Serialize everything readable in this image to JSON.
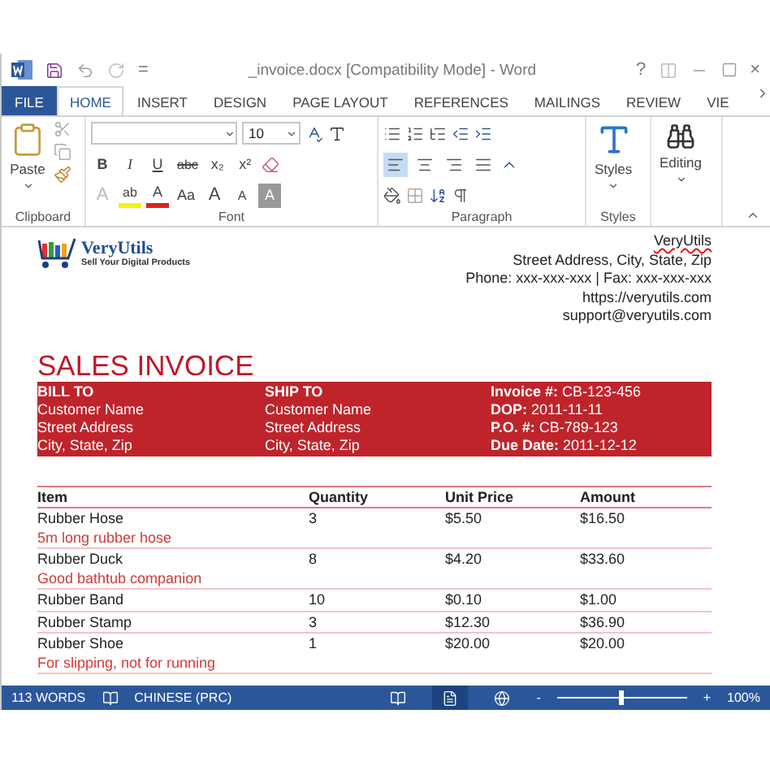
{
  "title_bar": {
    "customize": "=",
    "title": "_invoice.docx [Compatibility Mode] - Word",
    "help": "?",
    "close": "×"
  },
  "tabs": [
    {
      "label": "FILE",
      "kind": "file",
      "selected": false
    },
    {
      "label": "HOME",
      "kind": "tab",
      "selected": true
    },
    {
      "label": "INSERT",
      "kind": "tab",
      "selected": false
    },
    {
      "label": "DESIGN",
      "kind": "tab",
      "selected": false
    },
    {
      "label": "PAGE LAYOUT",
      "kind": "tab",
      "selected": false
    },
    {
      "label": "REFERENCES",
      "kind": "tab",
      "selected": false
    },
    {
      "label": "MAILINGS",
      "kind": "tab",
      "selected": false
    },
    {
      "label": "REVIEW",
      "kind": "tab",
      "selected": false
    },
    {
      "label": "VIE",
      "kind": "tab",
      "selected": false
    }
  ],
  "ribbon": {
    "paste_label": "Paste",
    "font_size": "10",
    "font_row1": [
      {
        "label": "B",
        "kind": "bold"
      },
      {
        "label": "I",
        "kind": "italic"
      },
      {
        "label": "U",
        "kind": "underline"
      },
      {
        "label": "abc",
        "kind": "strike"
      },
      {
        "label": "x₂",
        "kind": "plain"
      },
      {
        "label": "x²",
        "kind": "plain"
      }
    ],
    "font_row2": [
      {
        "label": "A",
        "kind": "effects"
      },
      {
        "label": "ab",
        "kind": "highlight"
      },
      {
        "label": "A",
        "kind": "color"
      },
      {
        "label": "Aa",
        "kind": "plain"
      },
      {
        "label": "A",
        "kind": "grow"
      },
      {
        "label": "A",
        "kind": "shrink"
      },
      {
        "label": "A",
        "kind": "shade"
      }
    ],
    "alignments": [
      {
        "kind": "left",
        "selected": true
      },
      {
        "kind": "center",
        "selected": false
      },
      {
        "kind": "right",
        "selected": false
      },
      {
        "kind": "justify",
        "selected": false
      }
    ],
    "styles_label": "Styles",
    "editing_label": "Editing",
    "groups": [
      "Clipboard",
      "Font",
      "Paragraph",
      "Styles"
    ]
  },
  "document": {
    "logo": {
      "name": "VeryUtils",
      "tagline": "Sell Your Digital Products"
    },
    "company": [
      {
        "text": "VeryUtils",
        "misspelled": true
      },
      {
        "text": "Street Address, City, State, Zip",
        "misspelled": false
      },
      {
        "text": "Phone: xxx-xxx-xxx | Fax: xxx-xxx-xxx",
        "misspelled": false
      },
      {
        "text": "https://veryutils.com",
        "misspelled": false
      },
      {
        "text": "support@veryutils.com",
        "misspelled": false
      }
    ],
    "heading": "SALES INVOICE",
    "info_columns": [
      [
        "**BILL TO**",
        "Customer Name",
        "Street Address",
        "City, State, Zip"
      ],
      [
        "**SHIP TO**",
        "Customer Name",
        "Street Address",
        "City, State, Zip"
      ],
      [
        "**Invoice #:** CB-123-456",
        "**DOP:** 2011-11-11",
        "**P.O. #:** CB-789-123",
        "**Due Date:** 2011-12-12"
      ]
    ],
    "columns": [
      "Item",
      "Quantity",
      "Unit Price",
      "Amount"
    ],
    "rows": [
      {
        "item": "Rubber Hose",
        "quantity": "3",
        "unit_price": "$5.50",
        "amount": "$16.50",
        "note": "5m long rubber hose"
      },
      {
        "item": "Rubber Duck",
        "quantity": "8",
        "unit_price": "$4.20",
        "amount": "$33.60",
        "note": "Good bathtub companion"
      },
      {
        "item": "Rubber Band",
        "quantity": "10",
        "unit_price": "$0.10",
        "amount": "$1.00"
      },
      {
        "item": "Rubber Stamp",
        "quantity": "3",
        "unit_price": "$12.30",
        "amount": "$36.90"
      },
      {
        "item": "Rubber Shoe",
        "quantity": "1",
        "unit_price": "$20.00",
        "amount": "$20.00",
        "note": "For slipping, not for running"
      }
    ]
  },
  "status_bar": {
    "words": "113 WORDS",
    "language": "CHINESE (PRC)",
    "views": [
      {
        "kind": "read",
        "selected": false
      },
      {
        "kind": "print",
        "selected": true
      },
      {
        "kind": "web",
        "selected": false
      }
    ],
    "zoom_out": "-",
    "zoom": {
      "level": 0.5
    },
    "zoom_in": "+",
    "zoom_percent": "100%"
  }
}
